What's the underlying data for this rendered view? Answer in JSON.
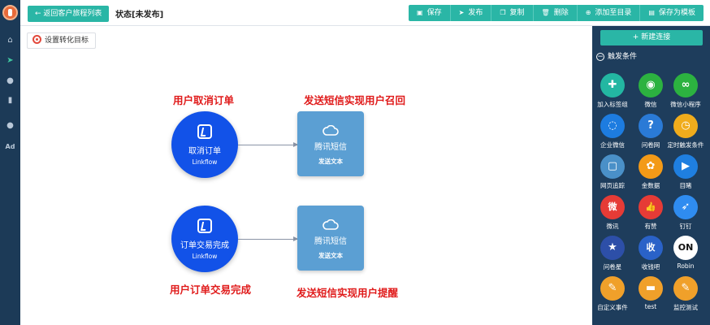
{
  "topbar": {
    "back_label": "← 返回客户旅程列表",
    "status": "状态[未发布]",
    "tools": [
      {
        "icon": "save-icon",
        "glyph": "▣",
        "label": "保存"
      },
      {
        "icon": "publish-icon",
        "glyph": "➤",
        "label": "发布"
      },
      {
        "icon": "copy-icon",
        "glyph": "❐",
        "label": "复制"
      },
      {
        "icon": "delete-icon",
        "glyph": "🗑",
        "label": "删除"
      },
      {
        "icon": "add-catalog-icon",
        "glyph": "⊕",
        "label": "添加至目录"
      },
      {
        "icon": "save-template-icon",
        "glyph": "▤",
        "label": "保存为模板"
      }
    ]
  },
  "rail": {
    "items": [
      {
        "icon": "home-icon",
        "glyph": "⌂"
      },
      {
        "icon": "send-icon",
        "glyph": "➤"
      },
      {
        "icon": "user-icon",
        "glyph": "●"
      },
      {
        "icon": "chart-icon",
        "glyph": "▮"
      },
      {
        "icon": "wechat-icon",
        "glyph": "●"
      },
      {
        "icon": "ad-icon",
        "glyph": "Ad"
      }
    ]
  },
  "canvas": {
    "goal_label": "设置转化目标",
    "labels": {
      "top_left": "用户取消订单",
      "top_right": "发送短信实现用户召回",
      "bottom_left": "用户订单交易完成",
      "bottom_right": "发送短信实现用户提醒"
    },
    "flows": [
      {
        "trigger": {
          "title": "取消订单",
          "sub": "Linkflow"
        },
        "action": {
          "title": "腾讯短信",
          "sub": "发送文本"
        }
      },
      {
        "trigger": {
          "title": "订单交易完成",
          "sub": "Linkflow"
        },
        "action": {
          "title": "腾讯短信",
          "sub": "发送文本"
        }
      }
    ]
  },
  "panel": {
    "new_connection": "+ 新建连接",
    "section_title": "触发条件",
    "items": [
      {
        "label": "加入标签组",
        "icon": "add-user-tag-icon",
        "color": "#23b7a2",
        "glyph": "✚"
      },
      {
        "label": "微信",
        "icon": "wechat-icon",
        "color": "#2cb240",
        "glyph": "◉"
      },
      {
        "label": "微信小程序",
        "icon": "mini-program-icon",
        "color": "#2cb240",
        "glyph": "∞"
      },
      {
        "label": "企业微信",
        "icon": "work-wechat-icon",
        "color": "#1d7ce0",
        "glyph": "◌"
      },
      {
        "label": "问卷网",
        "icon": "wenjuan-icon",
        "color": "#2a7ad6",
        "glyph": "?"
      },
      {
        "label": "定时触发条件",
        "icon": "timer-icon",
        "color": "#f0ac1c",
        "glyph": "◷"
      },
      {
        "label": "网页追踪",
        "icon": "web-tracking-icon",
        "color": "#4a90c8",
        "glyph": "▢"
      },
      {
        "label": "金数据",
        "icon": "jinshuju-icon",
        "color": "#f39a17",
        "glyph": "✿"
      },
      {
        "label": "目睹",
        "icon": "mudu-icon",
        "color": "#1f7fe0",
        "glyph": "▶"
      },
      {
        "label": "微讯",
        "icon": "weixun-icon",
        "color": "#e63b36",
        "glyph": "微"
      },
      {
        "label": "有赞",
        "icon": "youzan-icon",
        "color": "#e63b36",
        "glyph": "👍"
      },
      {
        "label": "钉钉",
        "icon": "dingtalk-icon",
        "color": "#2f8cf0",
        "glyph": "➶"
      },
      {
        "label": "问卷星",
        "icon": "wenjuanxing-icon",
        "color": "#2d4fa8",
        "glyph": "★"
      },
      {
        "label": "收钱吧",
        "icon": "shouqianba-icon",
        "color": "#2a62c8",
        "glyph": "收"
      },
      {
        "label": "Robin",
        "icon": "robin-icon",
        "color": "#ffffff",
        "glyph": "ON"
      },
      {
        "label": "自定义事件",
        "icon": "custom-event-icon",
        "color": "#f0a02a",
        "glyph": "✎"
      },
      {
        "label": "test",
        "icon": "test-icon",
        "color": "#f0a02a",
        "glyph": "▬"
      },
      {
        "label": "监控测试",
        "icon": "monitor-test-icon",
        "color": "#f0a02a",
        "glyph": "✎"
      }
    ]
  }
}
